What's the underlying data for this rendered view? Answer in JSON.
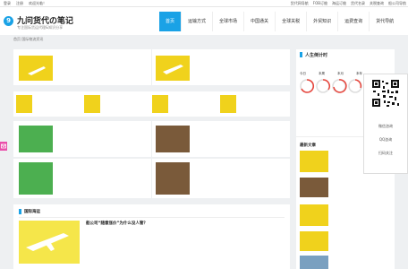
{
  "topbar": {
    "left": [
      "登录",
      "注册",
      "欢迎光临！"
    ],
    "right": [
      "货代网导航",
      "FOB订舱",
      "海运订舱",
      "货代名录",
      "关税查询",
      "船公司导航"
    ]
  },
  "header": {
    "logo_char": "9",
    "title": "九问货代の笔记",
    "subtitle": "专注国际货运代理&知识分享"
  },
  "nav": [
    "首页",
    "运输方式",
    "全球市场",
    "中国通关",
    "全球关税",
    "外贸知识",
    "运费查询",
    "货代导航"
  ],
  "breadcrumb": "首页 国际物流资讯",
  "top_left": {
    "badge": "",
    "title": "",
    "date": "",
    "views": ""
  },
  "top_right": {
    "title": "",
    "date": "",
    "views": ""
  },
  "mini_cards": [
    {
      "title": "",
      "sub": ""
    },
    {
      "title": "",
      "sub": ""
    },
    {
      "title": "",
      "sub": ""
    },
    {
      "title": "",
      "sub": ""
    }
  ],
  "mid_left": {
    "title": "",
    "date": "",
    "views": ""
  },
  "mid_right": {
    "title": "",
    "date": "",
    "views": ""
  },
  "low_left": {
    "title": "",
    "date": "",
    "views": ""
  },
  "low_right": {
    "title": "",
    "date": "",
    "views": ""
  },
  "section_bar": {
    "title": "国际海运",
    "more": ""
  },
  "feature": {
    "title": "船公司“随意涨价”为什么没人管？",
    "excerpt": "",
    "date": "",
    "views": ""
  },
  "sidebar": {
    "calendar_title": "人生倒计时",
    "calendar_date": "",
    "day_labels": [
      "今日",
      "本周",
      "本月",
      "本年"
    ],
    "day_values": [
      "",
      "",
      "",
      ""
    ],
    "latest_title": "最新文章",
    "latest": [
      {
        "title": "",
        "meta": ""
      },
      {
        "title": "",
        "meta": ""
      },
      {
        "title": "",
        "meta": ""
      },
      {
        "title": "",
        "meta": ""
      },
      {
        "title": "",
        "meta": ""
      }
    ]
  },
  "qr": {
    "items": [
      "微信咨询",
      "QQ咨询",
      "扫码关注",
      ""
    ]
  },
  "colors": {
    "accent": "#1aa2e6",
    "badge_red": "#e8453c",
    "thumb_yellow": "#f0d21c",
    "thumb_green": "#4caf50",
    "feature_yellow": "#f5e64a"
  }
}
